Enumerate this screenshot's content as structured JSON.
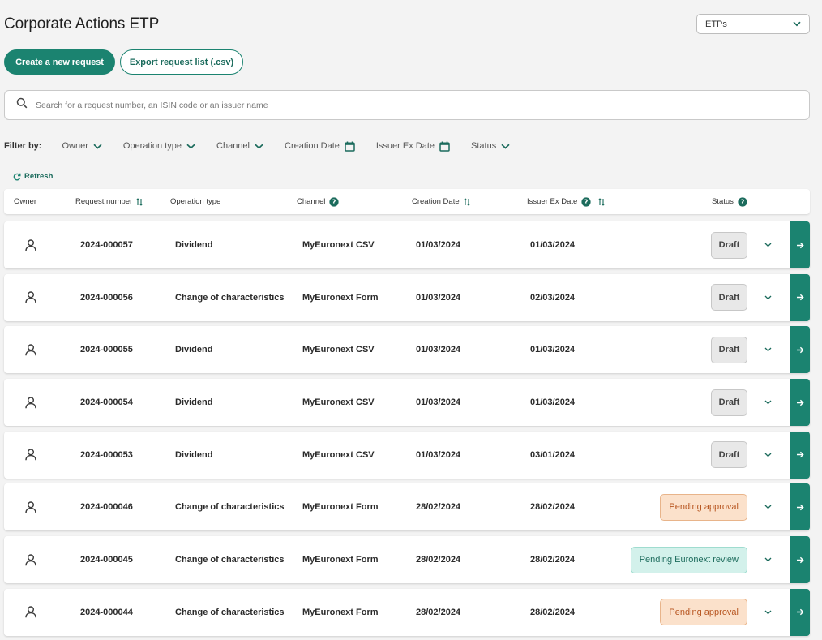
{
  "header": {
    "title": "Corporate Actions ETP",
    "market_select": "ETPs"
  },
  "actions": {
    "create": "Create a new request",
    "export": "Export request list (.csv)"
  },
  "search": {
    "placeholder": "Search for a request number, an ISIN code or an issuer name"
  },
  "filters": {
    "label": "Filter by:",
    "items": [
      "Owner",
      "Operation type",
      "Channel",
      "Creation Date",
      "Issuer Ex Date",
      "Status"
    ]
  },
  "refresh_label": "Refresh",
  "table": {
    "columns": [
      "Owner",
      "Request number",
      "Operation type",
      "Channel",
      "Creation Date",
      "Issuer Ex Date",
      "Status"
    ],
    "rows": [
      {
        "number": "2024-000057",
        "operation": "Dividend",
        "channel": "MyEuronext CSV",
        "created": "01/03/2024",
        "ex_date": "01/03/2024",
        "status": "Draft",
        "status_kind": "draft"
      },
      {
        "number": "2024-000056",
        "operation": "Change of characteristics",
        "channel": "MyEuronext Form",
        "created": "01/03/2024",
        "ex_date": "02/03/2024",
        "status": "Draft",
        "status_kind": "draft"
      },
      {
        "number": "2024-000055",
        "operation": "Dividend",
        "channel": "MyEuronext CSV",
        "created": "01/03/2024",
        "ex_date": "01/03/2024",
        "status": "Draft",
        "status_kind": "draft"
      },
      {
        "number": "2024-000054",
        "operation": "Dividend",
        "channel": "MyEuronext CSV",
        "created": "01/03/2024",
        "ex_date": "01/03/2024",
        "status": "Draft",
        "status_kind": "draft"
      },
      {
        "number": "2024-000053",
        "operation": "Dividend",
        "channel": "MyEuronext CSV",
        "created": "01/03/2024",
        "ex_date": "03/01/2024",
        "status": "Draft",
        "status_kind": "draft"
      },
      {
        "number": "2024-000046",
        "operation": "Change of characteristics",
        "channel": "MyEuronext Form",
        "created": "28/02/2024",
        "ex_date": "28/02/2024",
        "status": "Pending approval",
        "status_kind": "pending"
      },
      {
        "number": "2024-000045",
        "operation": "Change of characteristics",
        "channel": "MyEuronext Form",
        "created": "28/02/2024",
        "ex_date": "28/02/2024",
        "status": "Pending Euronext review",
        "status_kind": "review"
      },
      {
        "number": "2024-000044",
        "operation": "Change of characteristics",
        "channel": "MyEuronext Form",
        "created": "28/02/2024",
        "ex_date": "28/02/2024",
        "status": "Pending approval",
        "status_kind": "pending"
      }
    ]
  },
  "colors": {
    "accent": "#1b8370",
    "draft_bg": "#e8e8e8",
    "pending_bg": "#fbe1cb",
    "review_bg": "#d3f1eb"
  },
  "icons": {
    "select_chevron": "chevron-down-icon",
    "search": "search-icon",
    "filter_chevron": "chevron-down-icon",
    "filter_date": "calendar-icon",
    "refresh": "refresh-icon",
    "sort": "sort-icon",
    "help": "help-icon",
    "owner": "user-icon",
    "row_expand": "chevron-down-icon",
    "row_open": "arrow-right-icon"
  }
}
